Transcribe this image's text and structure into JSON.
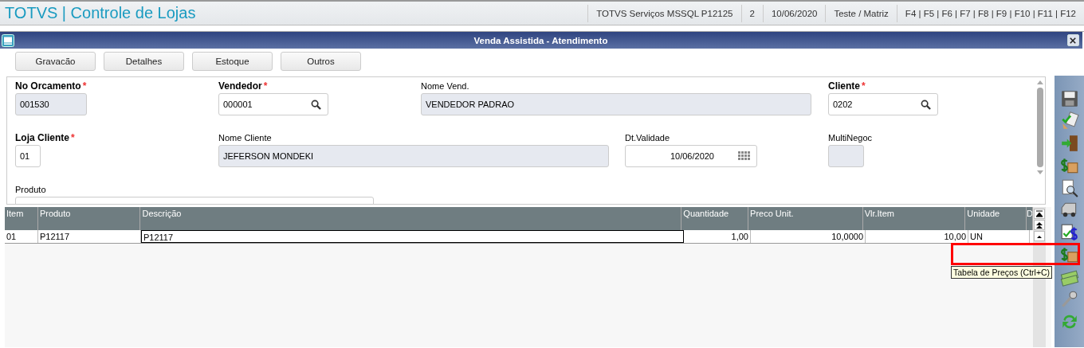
{
  "app_bar": {
    "title": "TOTVS | Controle de Lojas",
    "info": [
      "TOTVS Serviços MSSQL P12125",
      "2",
      "10/06/2020",
      "Teste / Matriz",
      "F4 | F5 | F6 | F7 | F8 | F9 | F10 | F11 | F12"
    ]
  },
  "window": {
    "title": "Venda Assistida - Atendimento"
  },
  "buttons": [
    "Gravacão",
    "Detalhes",
    "Estoque",
    "Outros"
  ],
  "fields": [
    {
      "label": "No Orcamento",
      "required": true,
      "required_mark": "*",
      "value": "001530",
      "kind": "readonly"
    },
    {
      "label": "Vendedor",
      "required": true,
      "required_mark": "*",
      "value": "000001",
      "kind": "lookup"
    },
    {
      "label": "Nome Vend.",
      "required": false,
      "value": "VENDEDOR PADRAO",
      "kind": "readonly"
    },
    {
      "label": "Cliente",
      "required": true,
      "required_mark": "*",
      "value": "0202",
      "kind": "lookup"
    },
    {
      "label": "Loja Cliente",
      "required": true,
      "required_mark": "*",
      "value": "01",
      "kind": "text"
    },
    {
      "label": "Nome Cliente",
      "required": false,
      "value": "JEFERSON MONDEKI",
      "kind": "readonly"
    },
    {
      "label": "Dt.Validade",
      "required": false,
      "value": "10/06/2020",
      "kind": "date"
    },
    {
      "label": "MultiNegoc",
      "required": false,
      "kind": "readonly"
    },
    {
      "label": "Produto",
      "required": false,
      "kind": "text"
    }
  ],
  "table": {
    "columns": [
      "Item",
      "Produto",
      "Descrição",
      "Quantidade",
      "Preco Unit.",
      "Vlr.Item",
      "Unidade",
      "D"
    ],
    "rows": [
      {
        "cells": [
          "01",
          "P12117",
          "P12117",
          "1,00",
          "10,0000",
          "10,00",
          "UN"
        ]
      }
    ]
  },
  "tooltip": "Tabela de Preços (Ctrl+C)"
}
